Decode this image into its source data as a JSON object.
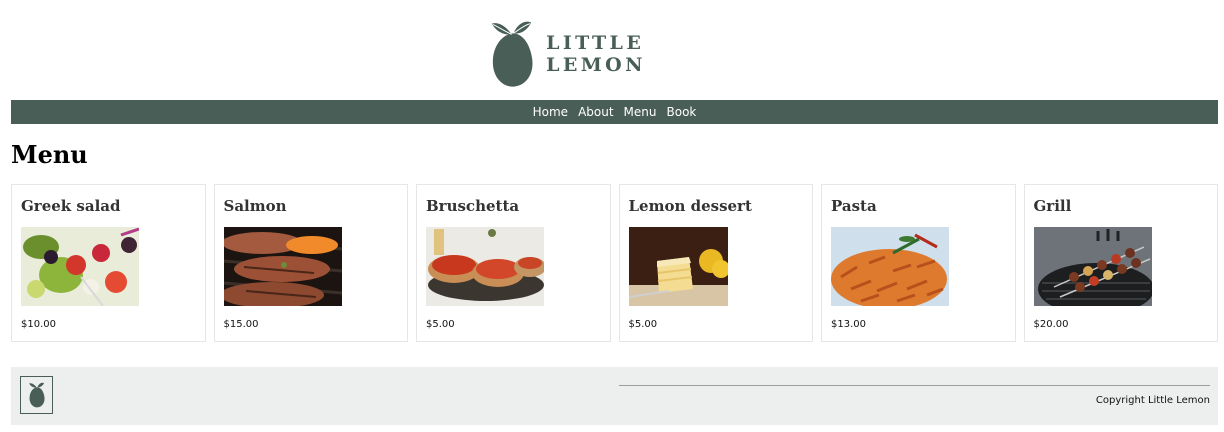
{
  "header": {
    "logo_text": "LITTLE LEMON"
  },
  "nav": {
    "items": [
      "Home",
      "About",
      "Menu",
      "Book"
    ]
  },
  "main": {
    "title": "Menu",
    "items": [
      {
        "name": "Greek salad",
        "price": "$10.00",
        "image": "greek-salad-photo"
      },
      {
        "name": "Salmon",
        "price": "$15.00",
        "image": "salmon-photo"
      },
      {
        "name": "Bruschetta",
        "price": "$5.00",
        "image": "bruschetta-photo"
      },
      {
        "name": "Lemon dessert",
        "price": "$5.00",
        "image": "lemon-dessert-photo"
      },
      {
        "name": "Pasta",
        "price": "$13.00",
        "image": "pasta-photo"
      },
      {
        "name": "Grill",
        "price": "$20.00",
        "image": "grill-photo"
      }
    ]
  },
  "footer": {
    "copyright": "Copyright Little Lemon"
  },
  "colors": {
    "brand_green": "#495e57",
    "footer_bg": "#edeeee"
  }
}
